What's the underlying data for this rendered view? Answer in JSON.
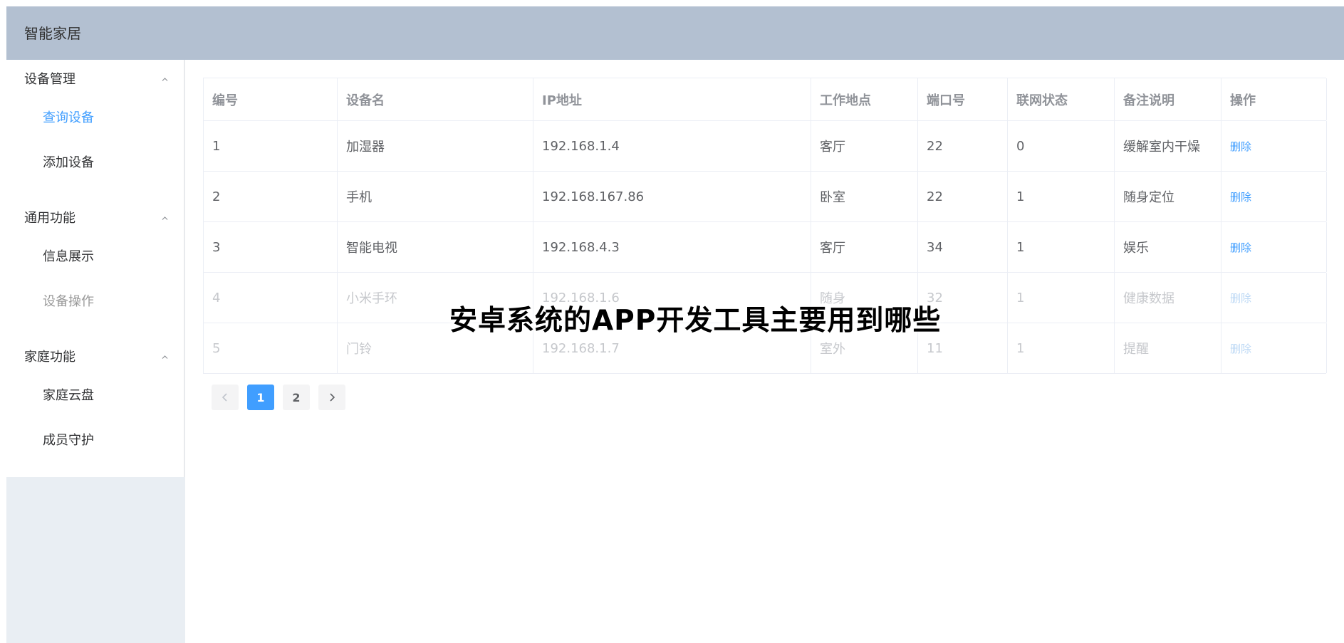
{
  "header": {
    "title": "智能家居",
    "bg_color": "#b3c0d1"
  },
  "sidebar": {
    "groups": [
      {
        "title": "设备管理",
        "icon": "chevron-up-icon",
        "items": [
          {
            "label": "查询设备",
            "state": "active"
          },
          {
            "label": "添加设备",
            "state": "normal"
          }
        ]
      },
      {
        "title": "通用功能",
        "icon": "chevron-up-icon",
        "items": [
          {
            "label": "信息展示",
            "state": "normal"
          },
          {
            "label": "设备操作",
            "state": "dim"
          }
        ]
      },
      {
        "title": "家庭功能",
        "icon": "chevron-up-icon",
        "items": [
          {
            "label": "家庭云盘",
            "state": "normal"
          },
          {
            "label": "成员守护",
            "state": "normal"
          }
        ]
      }
    ],
    "active_color": "#409eff"
  },
  "table": {
    "headers": [
      "编号",
      "设备名",
      "IP地址",
      "工作地点",
      "端口号",
      "联网状态",
      "备注说明",
      "操作"
    ],
    "rows": [
      {
        "id": "1",
        "name": "加湿器",
        "ip": "192.168.1.4",
        "location": "客厅",
        "port": "22",
        "status": "0",
        "note": "缓解室内干燥",
        "action": "删除"
      },
      {
        "id": "2",
        "name": "手机",
        "ip": "192.168.167.86",
        "location": "卧室",
        "port": "22",
        "status": "1",
        "note": "随身定位",
        "action": "删除"
      },
      {
        "id": "3",
        "name": "智能电视",
        "ip": "192.168.4.3",
        "location": "客厅",
        "port": "34",
        "status": "1",
        "note": "娱乐",
        "action": "删除"
      },
      {
        "id": "4",
        "name": "小米手环",
        "ip": "192.168.1.6",
        "location": "随身",
        "port": "32",
        "status": "1",
        "note": "健康数据",
        "action": "删除"
      },
      {
        "id": "5",
        "name": "门铃",
        "ip": "192.168.1.7",
        "location": "室外",
        "port": "11",
        "status": "1",
        "note": "提醒",
        "action": "删除"
      }
    ]
  },
  "pagination": {
    "prev_icon": "chevron-left-icon",
    "pages": [
      "1",
      "2"
    ],
    "current": "1",
    "next_icon": "chevron-right-icon",
    "active_color": "#409eff"
  },
  "overlay": {
    "caption": "安卓系统的APP开发工具主要用到哪些"
  }
}
